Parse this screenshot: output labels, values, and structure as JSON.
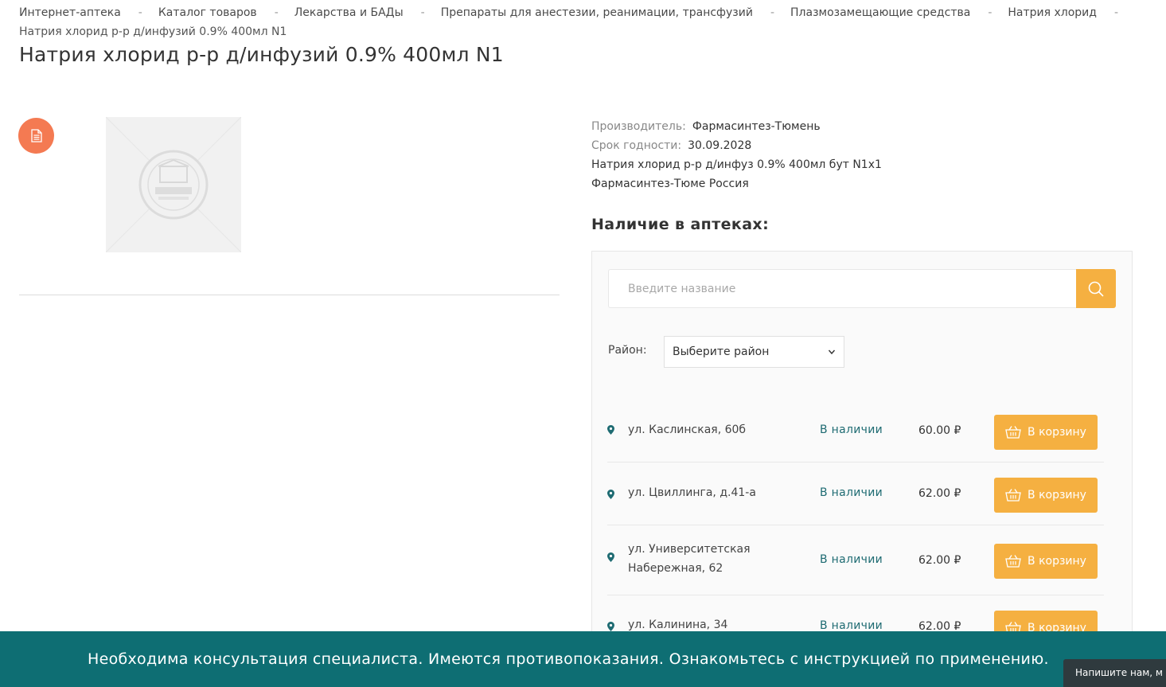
{
  "breadcrumb": {
    "items": [
      "Интернет-аптека",
      "Каталог товаров",
      "Лекарства и БАДы",
      "Препараты для анестезии, реанимации, трансфузий",
      "Плазмозамещающие средства",
      "Натрия хлорид"
    ],
    "separator": "-",
    "current": "Натрия хлорид р-р д/инфузий 0.9% 400мл N1"
  },
  "product": {
    "title": "Натрия хлорид р-р д/инфузий 0.9% 400мл N1",
    "manufacturer_label": "Производитель:",
    "manufacturer": "Фармасинтез-Тюмень",
    "expiry_label": "Срок годности:",
    "expiry": "30.09.2028",
    "description": "Натрия хлорид р-р д/инфуз 0.9% 400мл бут N1x1 Фармасинтез-Тюме Россия"
  },
  "availability": {
    "title": "Наличие в аптеках:",
    "search_placeholder": "Введите название",
    "district_label": "Район:",
    "district_select": "Выберите район",
    "cart_label": "В корзину",
    "pharmacies": [
      {
        "address": "ул. Каслинская, 60б",
        "status": "В наличии",
        "price": "60.00 ₽"
      },
      {
        "address": "ул. Цвиллинга, д.41-а",
        "status": "В наличии",
        "price": "62.00 ₽"
      },
      {
        "address": "ул. Университетская Набережная, 62",
        "status": "В наличии",
        "price": "62.00 ₽"
      },
      {
        "address": "ул. Калинина, 34",
        "status": "В наличии",
        "price": "62.00 ₽"
      }
    ]
  },
  "warning": {
    "text": "Необходима консультация специалиста. Имеются противопоказания. Ознакомьтесь с инструкцией по применению."
  },
  "chat": {
    "label": "Напишите нам, м"
  },
  "icons": {
    "document": "document-icon",
    "search": "search-icon",
    "pin": "map-pin-icon",
    "basket": "basket-icon",
    "chevron": "chevron-down-icon"
  },
  "colors": {
    "accent": "#f5b041",
    "badge": "#f47a52",
    "teal": "#0e6e73",
    "status": "#1e6b72"
  }
}
